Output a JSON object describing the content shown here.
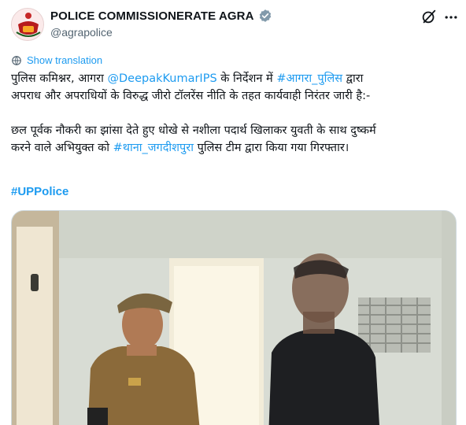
{
  "account": {
    "name": "POLICE COMMISSIONERATE AGRA",
    "handle": "@agrapolice"
  },
  "icons": {
    "avatar": "up-police-emblem",
    "verified": "verified-badge-icon",
    "grok": "grok-icon",
    "more": "more-options-icon",
    "translate": "globe-icon"
  },
  "colors": {
    "accent": "#1d9bf0",
    "text": "#0f1419",
    "secondary": "#536471"
  },
  "translate_label": "Show translation",
  "tweet": {
    "line1_a": "पुलिस कमिश्नर, आगरा ",
    "line1_mention": "@DeepakKumarIPS",
    "line1_b": " के निर्देशन में ",
    "line1_hashtag": "#आगरा_पुलिस",
    "line1_c": " द्वारा",
    "line2": "अपराध और अपराधियों के विरुद्ध जीरो टॉलरेंस नीति के तहत कार्यवाही निरंतर जारी है:-",
    "line3": "छल पूर्वक नौकरी का झांसा देते हुए धोखे से नशीला पदार्थ खिलाकर युवती के साथ दुष्कर्म",
    "line4_a": "करने वाले अभियुक्त को ",
    "line4_hashtag": "#थाना_जगदीशपुरा",
    "line4_b": " पुलिस टीम द्वारा किया गया गिरफ्तार।",
    "hashtag": "#UPPolice"
  }
}
